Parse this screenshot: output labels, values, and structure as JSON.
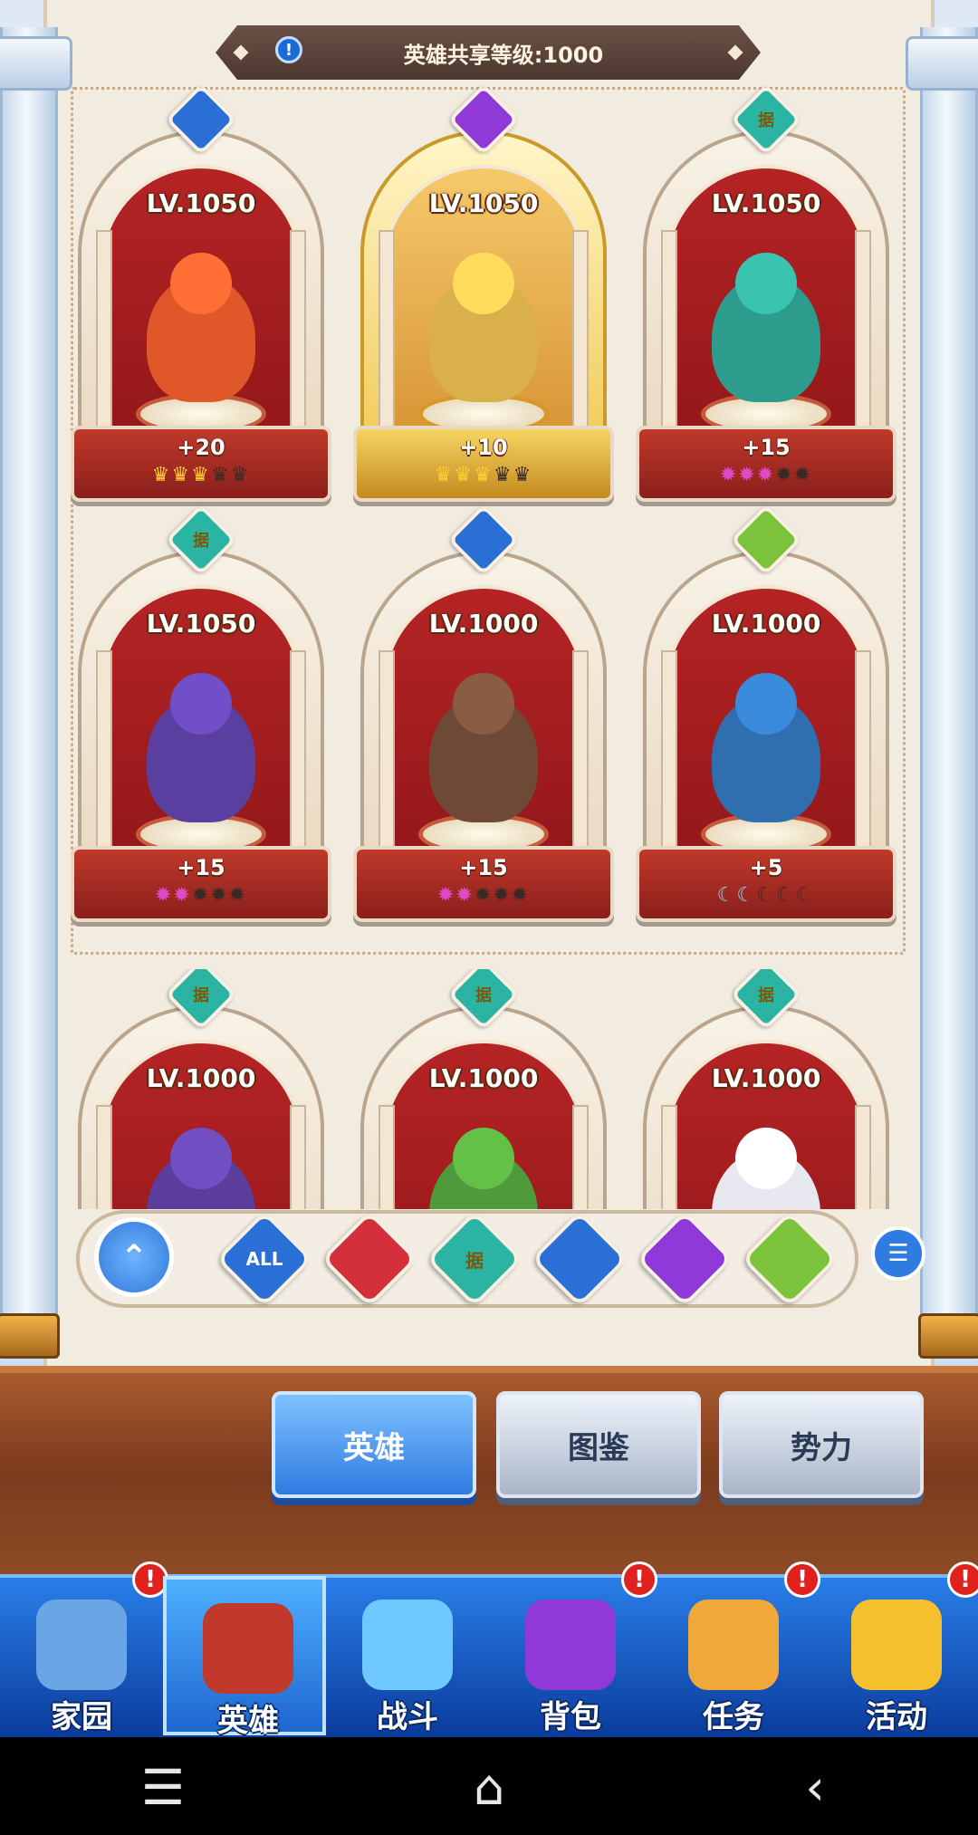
{
  "header": {
    "shared_level_label": "英雄共享等级:1000",
    "info_glyph": "!"
  },
  "heroes": [
    {
      "level": "LV.1050",
      "plus": "+20",
      "stars_on": 3,
      "stars_total": 5,
      "star_style": "crown",
      "faction_icon": "blue-orb-icon",
      "accent": "#2a6fd6"
    },
    {
      "level": "LV.1050",
      "plus": "+10",
      "stars_on": 3,
      "stars_total": 5,
      "star_style": "crown",
      "faction_icon": "purple-wings-icon",
      "accent": "#8f3ad8"
    },
    {
      "level": "LV.1050",
      "plus": "+15",
      "stars_on": 3,
      "stars_total": 5,
      "star_style": "pink",
      "faction_icon": "teal-seal-icon",
      "accent": "#2bb3a4"
    },
    {
      "level": "LV.1050",
      "plus": "+15",
      "stars_on": 2,
      "stars_total": 5,
      "star_style": "pink",
      "faction_icon": "teal-seal-icon",
      "accent": "#2bb3a4"
    },
    {
      "level": "LV.1000",
      "plus": "+15",
      "stars_on": 2,
      "stars_total": 5,
      "star_style": "pink",
      "faction_icon": "blue-orb-icon",
      "accent": "#2a6fd6"
    },
    {
      "level": "LV.1000",
      "plus": "+5",
      "stars_on": 2,
      "stars_total": 5,
      "star_style": "moon",
      "faction_icon": "green-bulb-icon",
      "accent": "#7cc23a"
    },
    {
      "level": "LV.1000",
      "faction_icon": "teal-seal-icon",
      "accent": "#2bb3a4"
    },
    {
      "level": "LV.1000",
      "faction_icon": "teal-seal-icon",
      "accent": "#2bb3a4"
    },
    {
      "level": "LV.1000",
      "faction_icon": "teal-seal-icon",
      "accent": "#2bb3a4"
    }
  ],
  "faction_glyph": "据",
  "filters": [
    {
      "label": "ALL",
      "color": "#2a6fd6",
      "icon": "all-filter-icon"
    },
    {
      "label": "",
      "color": "#d3303b",
      "icon": "red-bat-icon"
    },
    {
      "label": "据",
      "color": "#2bb3a4",
      "icon": "teal-seal-icon"
    },
    {
      "label": "",
      "color": "#2a6fd6",
      "icon": "blue-orb-icon"
    },
    {
      "label": "",
      "color": "#8f3ad8",
      "icon": "purple-wings-icon"
    },
    {
      "label": "",
      "color": "#7cc23a",
      "icon": "green-bulb-icon"
    }
  ],
  "fold_glyph": "⌃",
  "sort_glyph": "☰",
  "tabs": [
    "英雄",
    "图鉴",
    "势力"
  ],
  "nav": [
    {
      "label": "家园",
      "alert": true
    },
    {
      "label": "英雄",
      "alert": false,
      "active": true
    },
    {
      "label": "战斗",
      "alert": false
    },
    {
      "label": "背包",
      "alert": true
    },
    {
      "label": "任务",
      "alert": true
    },
    {
      "label": "活动",
      "alert": true
    }
  ],
  "alert_glyph": "!",
  "system": {
    "menu": "☰",
    "home": "⌂",
    "back": "‹"
  },
  "colors": {
    "nav_bg": "#1e63d1",
    "tab_active": "#2f7be0",
    "card_red": "#b52425",
    "gold_card": "#f0c54a"
  }
}
